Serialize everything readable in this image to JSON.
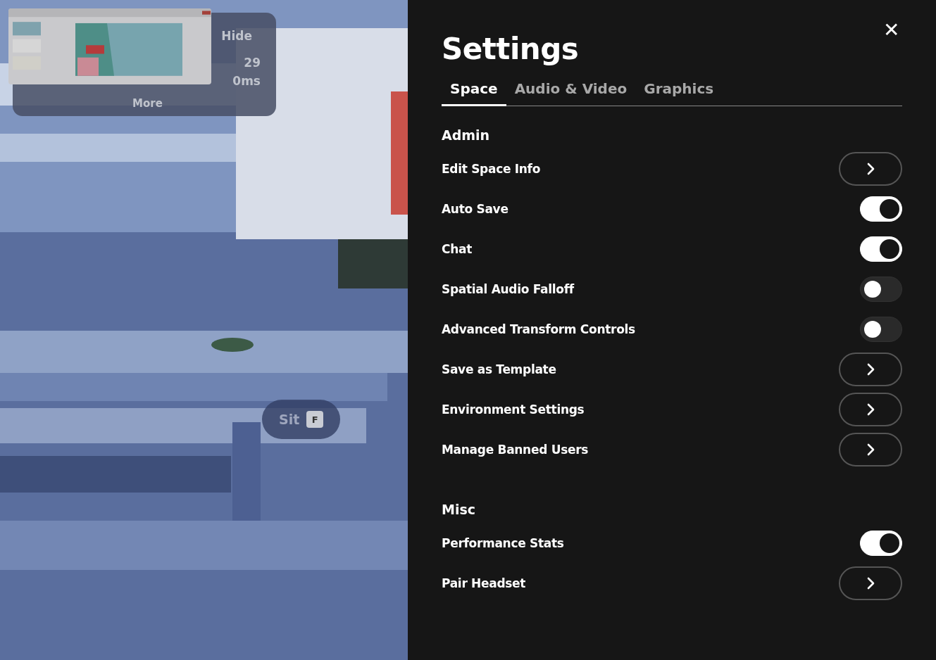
{
  "scene": {
    "kind": "picture",
    "stats": {
      "hide": "Hide",
      "fps": "29",
      "latency": "0ms",
      "more": "More"
    },
    "prompt": {
      "label": "Sit",
      "key": "F"
    }
  },
  "settings": {
    "title": "Settings",
    "close": "✕",
    "tabs": [
      {
        "label": "Space",
        "selected": true
      },
      {
        "label": "Audio & Video",
        "selected": false
      },
      {
        "label": "Graphics",
        "selected": false
      }
    ],
    "sections": [
      {
        "heading": "Admin",
        "rows": [
          {
            "label": "Edit Space Info",
            "kind": "link"
          },
          {
            "label": "Auto Save",
            "kind": "toggle",
            "on": true
          },
          {
            "label": "Chat",
            "kind": "toggle",
            "on": true
          },
          {
            "label": "Spatial Audio Falloff",
            "kind": "toggle",
            "on": false
          },
          {
            "label": "Advanced Transform Controls",
            "kind": "toggle",
            "on": false
          },
          {
            "label": "Save as Template",
            "kind": "link"
          },
          {
            "label": "Environment Settings",
            "kind": "link"
          },
          {
            "label": "Manage Banned Users",
            "kind": "link"
          }
        ]
      },
      {
        "heading": "Misc",
        "rows": [
          {
            "label": "Performance Stats",
            "kind": "toggle",
            "on": true
          },
          {
            "label": "Pair Headset",
            "kind": "link"
          }
        ]
      }
    ]
  }
}
